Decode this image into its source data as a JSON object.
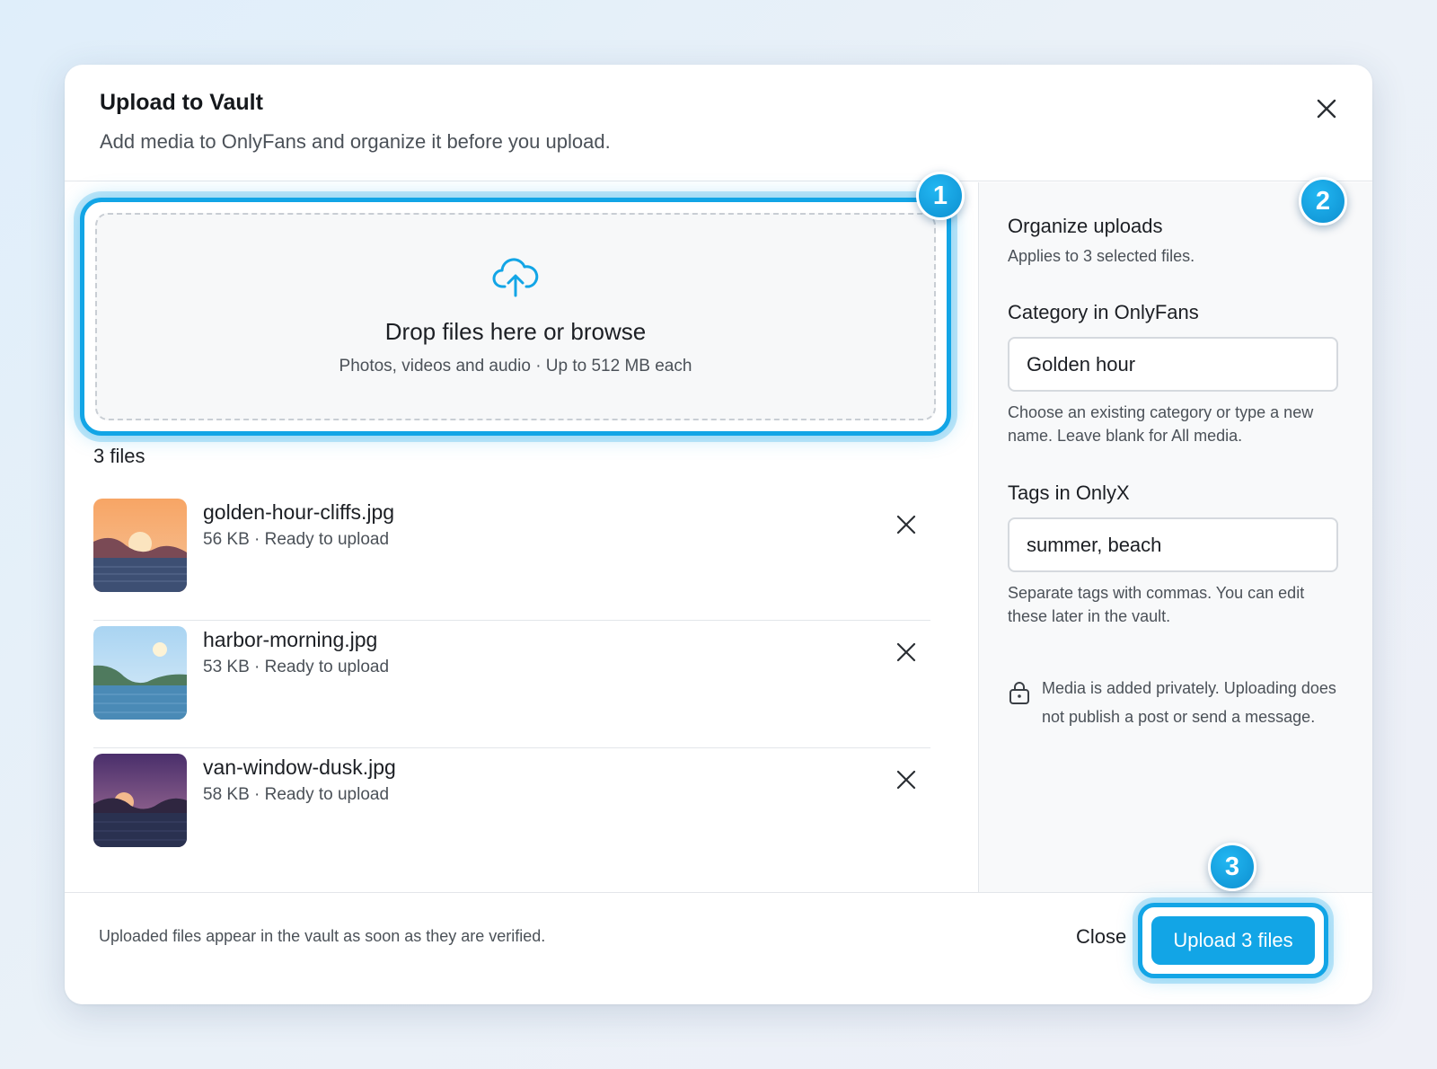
{
  "dialog": {
    "title": "Upload to Vault",
    "subtitle": "Add media to OnlyFans and organize it before you upload."
  },
  "dropzone": {
    "title": "Drop files here or browse",
    "subtitle": "Photos, videos and audio · Up to 512 MB each"
  },
  "badges": [
    "1",
    "2",
    "3"
  ],
  "files": {
    "count_label": "3 files",
    "items": [
      {
        "name": "golden-hour-cliffs.jpg",
        "meta": "56 KB · Ready to upload"
      },
      {
        "name": "harbor-morning.jpg",
        "meta": "53 KB · Ready to upload"
      },
      {
        "name": "van-window-dusk.jpg",
        "meta": "58 KB · Ready to upload"
      }
    ]
  },
  "organize": {
    "title": "Organize uploads",
    "subtitle": "Applies to 3 selected files.",
    "category": {
      "label": "Category in OnlyFans",
      "value": "Golden hour",
      "help": "Choose an existing category or type a new name. Leave blank for All media."
    },
    "tags": {
      "label": "Tags in OnlyX",
      "value": "summer, beach",
      "help": "Separate tags with commas. You can edit these later in the vault."
    },
    "privacy_note": "Media is added privately. Uploading does not publish a post or send a message."
  },
  "footer": {
    "note": "Uploaded files appear in the vault as soon as they are verified.",
    "close_label": "Close",
    "upload_label": "Upload 3 files"
  },
  "colors": {
    "accent": "#12a5e6",
    "text": "#1c1f24",
    "muted": "#4b5158"
  }
}
